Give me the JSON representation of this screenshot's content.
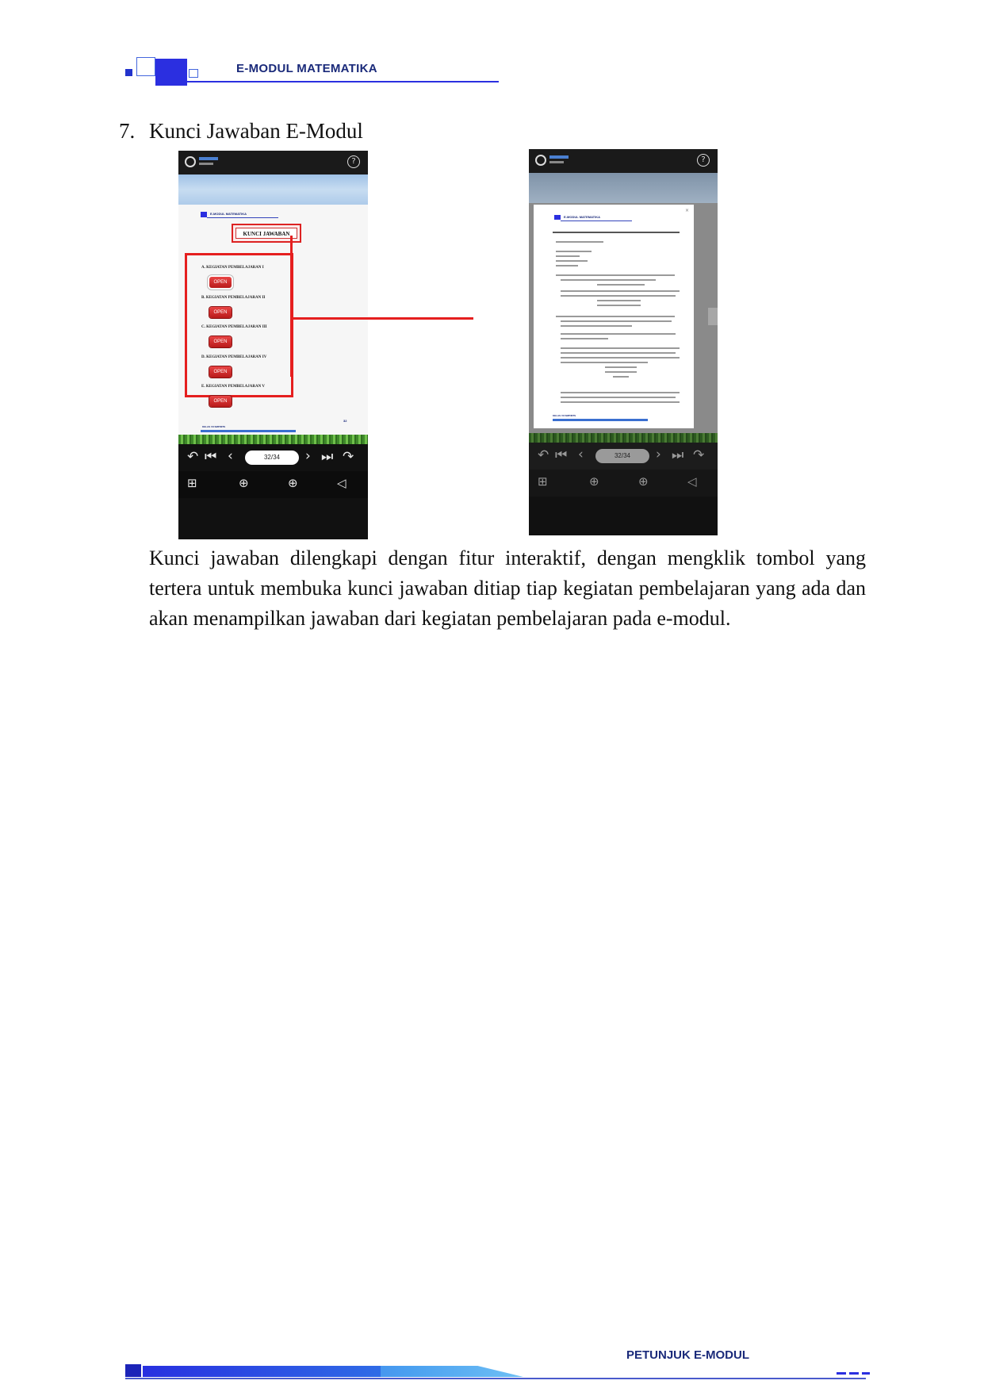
{
  "header": {
    "title": "E-MODUL MATEMATIKA"
  },
  "section": {
    "number": "7.",
    "title": "Kunci Jawaban E-Modul"
  },
  "left_phone": {
    "help_icon": "question-circle-icon",
    "mini_header": "E-MODUL MATEMATIKA",
    "kunci_title": "KUNCI JAWABAN",
    "activities": [
      {
        "label": "A. KEGIATAN PEMBELAJARAN I",
        "button": "OPEN"
      },
      {
        "label": "B. KEGIATAN PEMBELAJARAN II",
        "button": "OPEN"
      },
      {
        "label": "C. KEGIATAN PEMBELAJARAN III",
        "button": "OPEN"
      },
      {
        "label": "D. KEGIATAN PEMBELAJARAN IV",
        "button": "OPEN"
      },
      {
        "label": "E. KEGIATAN PEMBELAJARAN V",
        "button": "OPEN"
      }
    ],
    "page_number": "32",
    "footer_text": "KELAS VII SMP/MTS",
    "page_indicator": "32/34"
  },
  "right_phone": {
    "mini_header": "E-MODUL MATEMATIKA",
    "close_label": "×",
    "footer_text": "KELAS VII SMP/MTS",
    "page_indicator": "32/34"
  },
  "paragraph": "Kunci jawaban dilengkapi dengan fitur interaktif, dengan mengklik tombol yang tertera untuk membuka kunci jawaban ditiap tiap kegiatan pembelajaran yang ada dan akan menampilkan jawaban dari kegiatan pembelajaran pada e-modul.",
  "footer": {
    "title": "PETUNJUK E-MODUL"
  },
  "colors": {
    "accent": "#2b2fe0",
    "highlight": "#e51f1f",
    "header_text": "#1a2a7a"
  }
}
